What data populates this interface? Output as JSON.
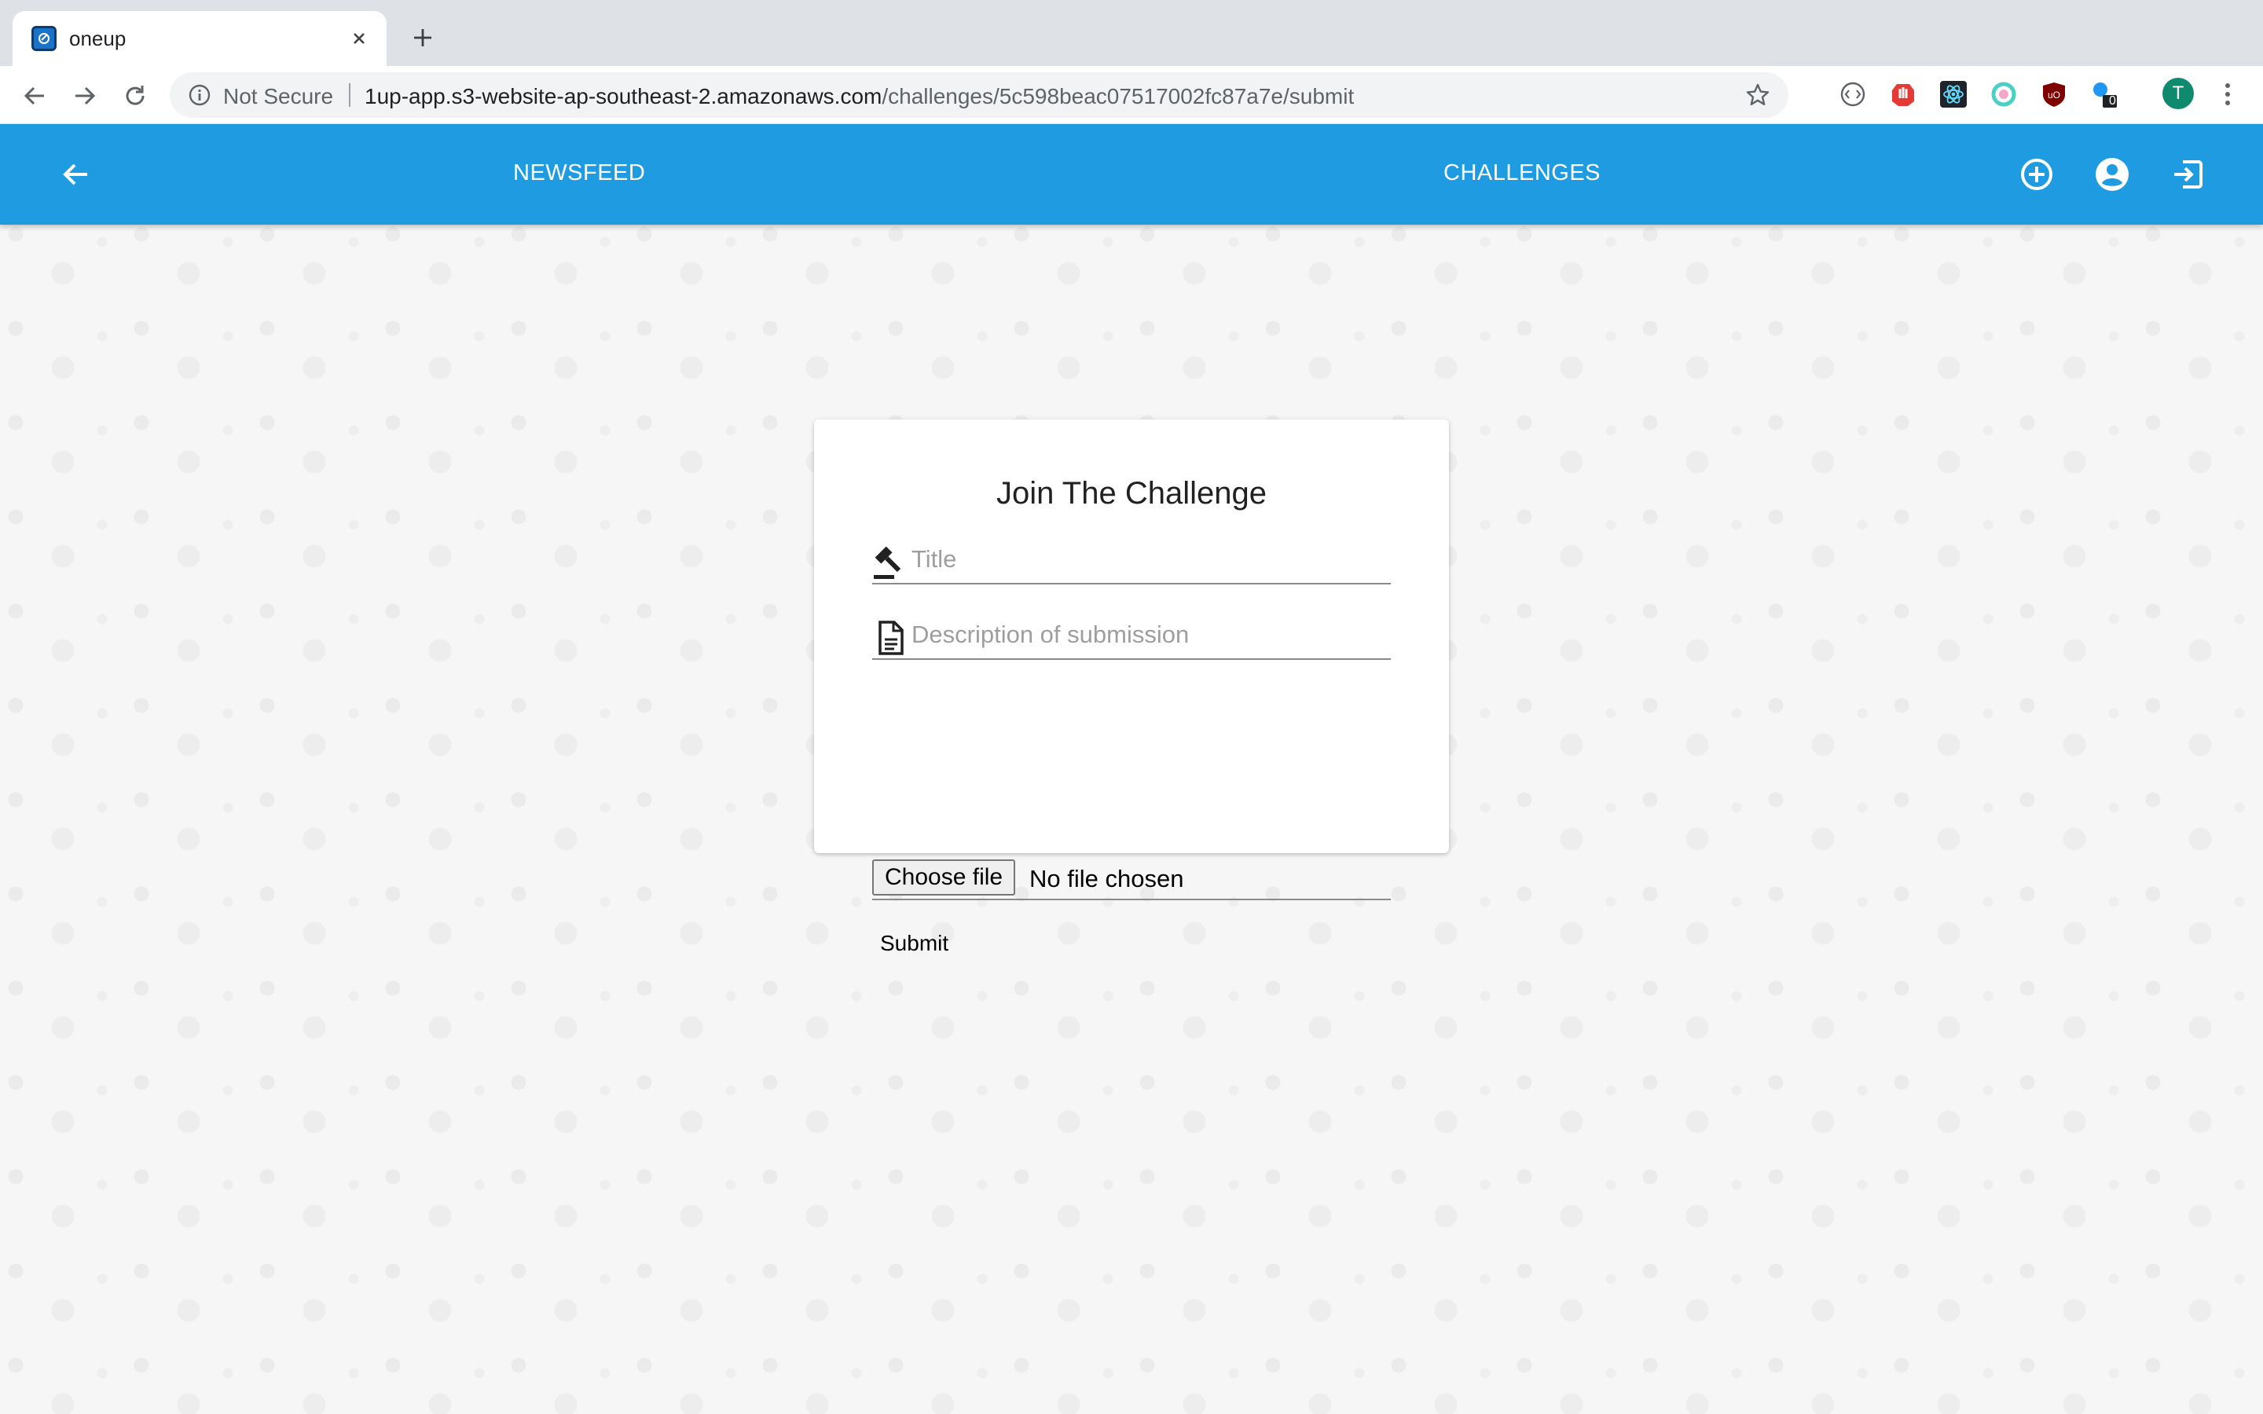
{
  "browser": {
    "tab_title": "oneup",
    "security_label": "Not Secure",
    "url_host": "1up-app.s3-website-ap-southeast-2.amazonaws.com",
    "url_path": "/challenges/5c598beac07517002fc87a7e/submit",
    "extension_badge_count": "0",
    "profile_initial": "T",
    "icons": [
      "favicon-icon",
      "close-tab-icon",
      "new-tab-icon",
      "back-icon",
      "forward-icon",
      "reload-icon",
      "info-icon",
      "star-icon"
    ]
  },
  "appbar": {
    "newsfeed_label": "NEWSFEED",
    "challenges_label": "CHALLENGES",
    "background_color": "#1e9be1",
    "icons": [
      "arrow-back-icon",
      "add-circle-icon",
      "account-circle-icon",
      "logout-icon"
    ]
  },
  "form": {
    "title": "Join The Challenge",
    "title_placeholder": "Title",
    "description_placeholder": "Description of submission",
    "file_button_label": "Choose file",
    "file_status": "No file chosen",
    "submit_label": "Submit"
  }
}
